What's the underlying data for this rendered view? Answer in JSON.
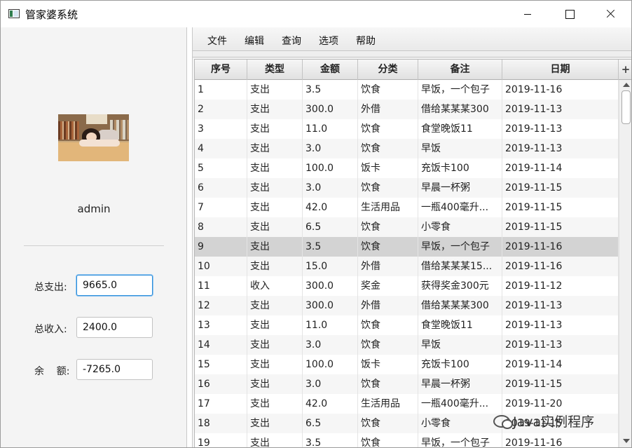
{
  "window": {
    "title": "管家婆系统",
    "icon": "app-window-icon",
    "controls": [
      "minimize-icon",
      "maximize-icon",
      "close-icon"
    ]
  },
  "profile": {
    "avatar": "user-photo",
    "username": "admin"
  },
  "summary": {
    "total_expense_label": "总支出:",
    "total_expense_value": "9665.0",
    "total_income_label": "总收入:",
    "total_income_value": "2400.0",
    "balance_label": "余    额:",
    "balance_value": "-7265.0"
  },
  "menu": [
    "文件",
    "编辑",
    "查询",
    "选项",
    "帮助"
  ],
  "table": {
    "columns": [
      "序号",
      "类型",
      "金额",
      "分类",
      "备注",
      "日期"
    ],
    "add_column_icon": "+",
    "selected_row": 9,
    "rows": [
      [
        "1",
        "支出",
        "3.5",
        "饮食",
        "早饭，一个包子",
        "2019-11-16"
      ],
      [
        "2",
        "支出",
        "300.0",
        "外借",
        "借给某某某300",
        "2019-11-13"
      ],
      [
        "3",
        "支出",
        "11.0",
        "饮食",
        "食堂晚饭11",
        "2019-11-13"
      ],
      [
        "4",
        "支出",
        "3.0",
        "饮食",
        "早饭",
        "2019-11-13"
      ],
      [
        "5",
        "支出",
        "100.0",
        "饭卡",
        "充饭卡100",
        "2019-11-14"
      ],
      [
        "6",
        "支出",
        "3.0",
        "饮食",
        "早晨一杯粥",
        "2019-11-15"
      ],
      [
        "7",
        "支出",
        "42.0",
        "生活用品",
        "一瓶400毫升...",
        "2019-11-15"
      ],
      [
        "8",
        "支出",
        "6.5",
        "饮食",
        "小零食",
        "2019-11-15"
      ],
      [
        "9",
        "支出",
        "3.5",
        "饮食",
        "早饭，一个包子",
        "2019-11-16"
      ],
      [
        "10",
        "支出",
        "15.0",
        "外借",
        "借给某某某15...",
        "2019-11-16"
      ],
      [
        "11",
        "收入",
        "300.0",
        "奖金",
        "获得奖金300元",
        "2019-11-12"
      ],
      [
        "12",
        "支出",
        "300.0",
        "外借",
        "借给某某某300",
        "2019-11-13"
      ],
      [
        "13",
        "支出",
        "11.0",
        "饮食",
        "食堂晚饭11",
        "2019-11-13"
      ],
      [
        "14",
        "支出",
        "3.0",
        "饮食",
        "早饭",
        "2019-11-13"
      ],
      [
        "15",
        "支出",
        "100.0",
        "饭卡",
        "充饭卡100",
        "2019-11-14"
      ],
      [
        "16",
        "支出",
        "3.0",
        "饮食",
        "早晨一杯粥",
        "2019-11-15"
      ],
      [
        "17",
        "支出",
        "42.0",
        "生活用品",
        "一瓶400毫升...",
        "2019-11-20"
      ],
      [
        "18",
        "支出",
        "6.5",
        "饮食",
        "小零食",
        "2019-11-15"
      ],
      [
        "19",
        "支出",
        "3.5",
        "饮食",
        "早饭，一个包子",
        "2019-11-16"
      ]
    ]
  },
  "watermark": {
    "text": "Java实例程序",
    "icon": "wechat-icon"
  },
  "colors": {
    "selected_row": "#d3d3d3",
    "focus_border": "#2b8ddb",
    "panel_bg": "#f4f4f4"
  }
}
